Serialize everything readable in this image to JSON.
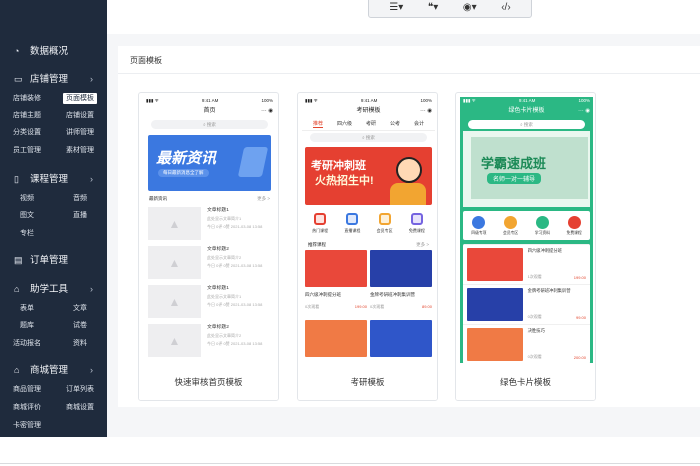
{
  "toolbar": {
    "items": [
      "list-icon",
      "quote-icon",
      "eye-icon",
      "code-icon"
    ]
  },
  "sidebar": {
    "data_overview": "数据概况",
    "store": {
      "label": "店铺管理",
      "items": [
        "店铺装修",
        "页面模板",
        "店铺主题",
        "店铺设置",
        "分类设置",
        "讲师管理",
        "员工管理",
        "素材管理"
      ],
      "active": "页面模板"
    },
    "course": {
      "label": "课程管理",
      "items": [
        "视频",
        "音频",
        "图文",
        "直播",
        "专栏"
      ]
    },
    "orders": {
      "label": "订单管理"
    },
    "tools": {
      "label": "助学工具",
      "items": [
        "表单",
        "文章",
        "题库",
        "试卷",
        "活动报名",
        "资料"
      ]
    },
    "mall": {
      "label": "商城管理",
      "items": [
        "商品管理",
        "订单列表",
        "商城评价",
        "商城设置",
        "卡密管理"
      ]
    }
  },
  "panel": {
    "title": "页面模板"
  },
  "cards": [
    {
      "label": "快速审核首页模板",
      "status_time": "9:41 AM",
      "status_batt": "100%",
      "page_title": "首页",
      "search": "搜索",
      "banner_title": "最新资讯",
      "banner_sub": "每日最新消息全了解",
      "section": "最新资讯",
      "more": "更多 >",
      "articles": [
        {
          "title": "文章标题1",
          "summary": "此处显示文章简介1",
          "meta": "今日  0评  0赞  2021-03-08 13:58"
        },
        {
          "title": "文章标题2",
          "summary": "此处显示文章简介2",
          "meta": "今日  0评  0赞  2021-03-08 13:58"
        },
        {
          "title": "文章标题1",
          "summary": "此处显示文章简介1",
          "meta": "今日  0评  0赞  2021-03-08 13:58"
        },
        {
          "title": "文章标题2",
          "summary": "此处显示文章简介2",
          "meta": "今日  0评  0赞  2021-03-08 13:58"
        }
      ]
    },
    {
      "label": "考研模板",
      "status_time": "9:41 AM",
      "status_batt": "100%",
      "page_title": "考研模板",
      "tabs": [
        "推荐",
        "四六级",
        "考研",
        "公考",
        "会计"
      ],
      "search": "搜索",
      "banner_l1": "考研冲刺班",
      "banner_l2": "火热招生中!",
      "icons": [
        "热门课程",
        "直播课程",
        "会员专区",
        "免费课程"
      ],
      "section": "推荐课程",
      "more": "更多 >",
      "courses": [
        {
          "title": "四六级冲刺提分班",
          "count": "0次观看",
          "price": "199.00",
          "img_text": "四六级冲刺提分班"
        },
        {
          "title": "金牌考研班冲刺集训营",
          "count": "0次观看",
          "price": "89.00",
          "img_text": "冲刺集训营"
        }
      ]
    },
    {
      "label": "绿色卡片模板",
      "status_time": "9:41 AM",
      "status_batt": "100%",
      "page_title": "绿色卡片模板",
      "search": "搜索",
      "banner_title": "学霸速成班",
      "banner_sub": "名师一对一辅导",
      "icons": [
        "四级专项",
        "会员专区",
        "学习资料",
        "免费课程"
      ],
      "courses": [
        {
          "title": "四六级冲刺提分班",
          "count": "1次观看",
          "price": "199.00"
        },
        {
          "title": "金牌考研班冲刺集训营",
          "count": "0次观看",
          "price": "99.00"
        },
        {
          "title": "决胜技巧",
          "count": "0次观看",
          "price": "200.00"
        }
      ]
    }
  ],
  "colors": {
    "sidebar": "#1f2b3d",
    "accent_blue": "#3b78e0",
    "accent_red": "#e54031",
    "accent_green": "#2bb884"
  }
}
